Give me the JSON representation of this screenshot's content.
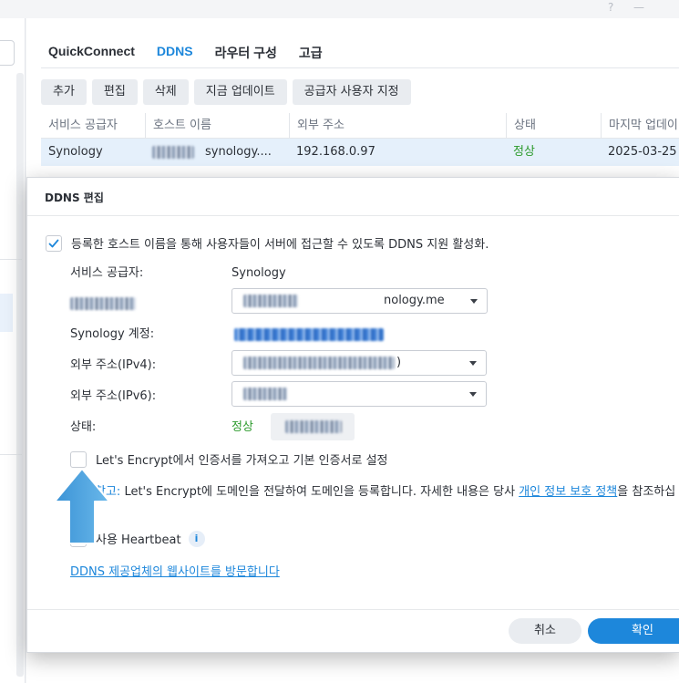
{
  "window": {
    "help_icon": "?",
    "minimize_icon": "—"
  },
  "tabs": [
    {
      "label": "QuickConnect",
      "active": false
    },
    {
      "label": "DDNS",
      "active": true
    },
    {
      "label": "라우터 구성",
      "active": false
    },
    {
      "label": "고급",
      "active": false
    }
  ],
  "toolbar": {
    "add": "추가",
    "edit": "편집",
    "delete": "삭제",
    "update_now": "지금 업데이트",
    "custom_provider": "공급자 사용자 지정"
  },
  "table": {
    "columns": [
      "서비스 공급자",
      "호스트 이름",
      "외부 주소",
      "상태",
      "마지막 업데이"
    ],
    "rows": [
      {
        "provider": "Synology",
        "hostname": "synology....",
        "address": "192.168.0.97",
        "status": "정상",
        "last_update": "2025-03-25"
      }
    ]
  },
  "dialog": {
    "title": "DDNS 편집",
    "enable_label": "등록한 호스트 이름을 통해 사용자들이 서버에 접근할 수 있도록 DDNS 지원 활성화.",
    "enable_checked": true,
    "fields": {
      "provider_label": "서비스 공급자:",
      "provider_value": "Synology",
      "hostname_value": "nology.me",
      "account_label": "Synology 계정:",
      "ipv4_label": "외부 주소(IPv4):",
      "ipv4_value": ")",
      "ipv6_label": "외부 주소(IPv6):",
      "status_label": "상태:",
      "status_value": "정상"
    },
    "letsencrypt_label": "Let's Encrypt에서 인증서를 가져오고 기본 인증서로 설정",
    "letsencrypt_checked": false,
    "note_tag": "참고:",
    "note_text": " Let's Encrypt에 도메인을 전달하여 도메인을 등록합니다. 자세한 내용은 당사 ",
    "note_link": "개인 정보 보호 정책",
    "note_suffix": "을 참조하십",
    "heartbeat_label": "사용 Heartbeat",
    "info_icon": "i",
    "provider_site_link": "DDNS 제공업체의 웹사이트를 방문합니다",
    "cancel": "취소",
    "ok": "확인"
  },
  "colors": {
    "accent": "#1d87db",
    "ok_green": "#2c9a2c",
    "arrow": "#4aa3df"
  }
}
